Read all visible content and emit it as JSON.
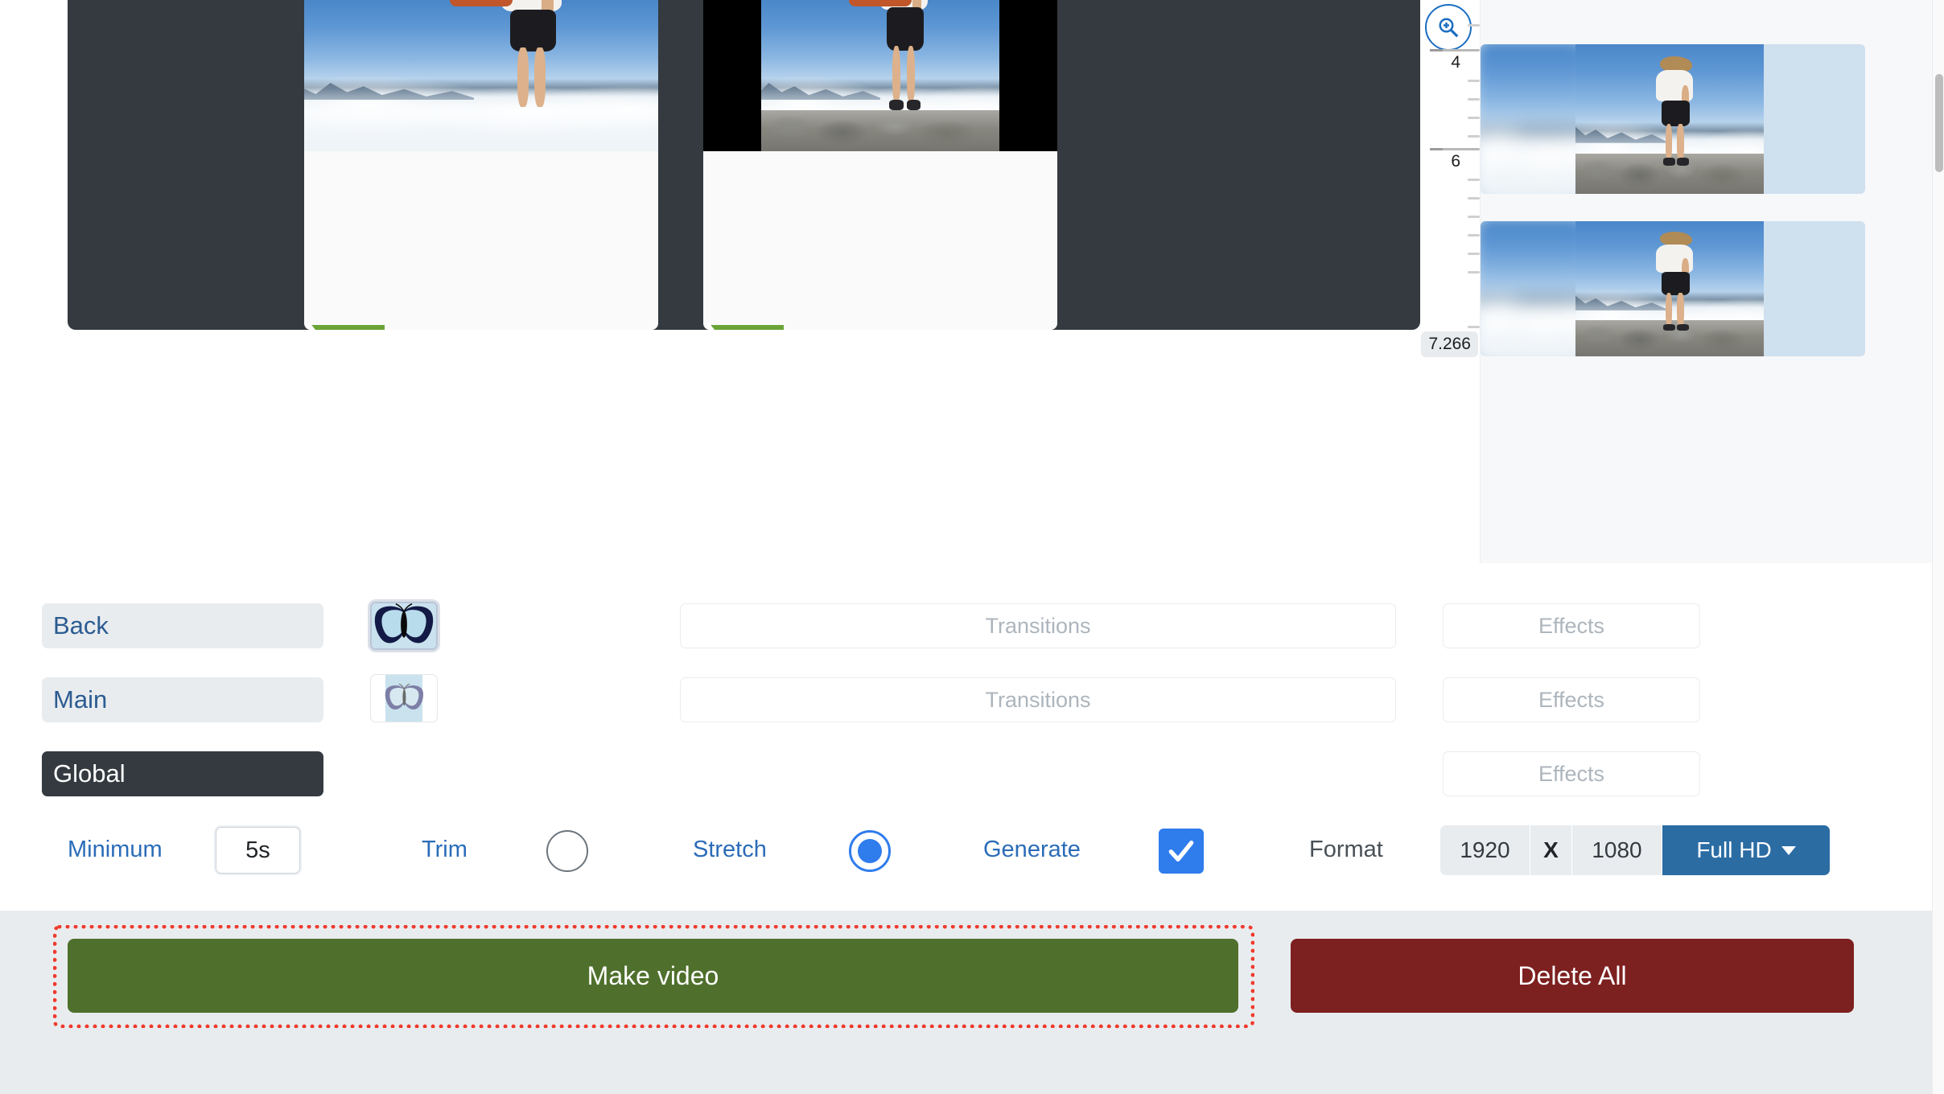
{
  "timeline": {
    "ruler": {
      "zoom_icon": "zoom-in-icon",
      "labels": [
        "4",
        "6"
      ],
      "current_time": "7.266"
    },
    "clips": [
      {
        "tab_color": "#c0562a",
        "marker_color": "#6aa436"
      },
      {
        "tab_color": "#c0562a",
        "marker_color": "#6aa436"
      }
    ]
  },
  "layers": [
    {
      "label": "Back",
      "thumbnail": "butterfly-dark-thumbnail",
      "selected": true,
      "transitions_label": "Transitions",
      "effects_label": "Effects"
    },
    {
      "label": "Main",
      "thumbnail": "butterfly-light-thumbnail",
      "selected": false,
      "transitions_label": "Transitions",
      "effects_label": "Effects"
    },
    {
      "label": "Global",
      "thumbnail": null,
      "selected": false,
      "transitions_label": null,
      "effects_label": "Effects"
    }
  ],
  "options": {
    "minimum_label": "Minimum",
    "minimum_value": "5s",
    "trim_label": "Trim",
    "trim_selected": false,
    "stretch_label": "Stretch",
    "stretch_selected": true,
    "generate_label": "Generate",
    "generate_checked": true,
    "checkmark": "✓"
  },
  "format": {
    "label": "Format",
    "width": "1920",
    "separator": "X",
    "height": "1080",
    "preset": "Full HD",
    "caret_icon": "chevron-down-icon"
  },
  "footer": {
    "make_video_label": "Make video",
    "delete_all_label": "Delete All",
    "make_video_color": "#4f702c",
    "delete_all_color": "#7d2020",
    "highlight_color": "#ef3b2c"
  },
  "colors": {
    "accent_blue": "#2f7ced",
    "link_blue": "#2b6cb8",
    "dark_panel": "#343a40",
    "surface": "#e9ecef"
  }
}
